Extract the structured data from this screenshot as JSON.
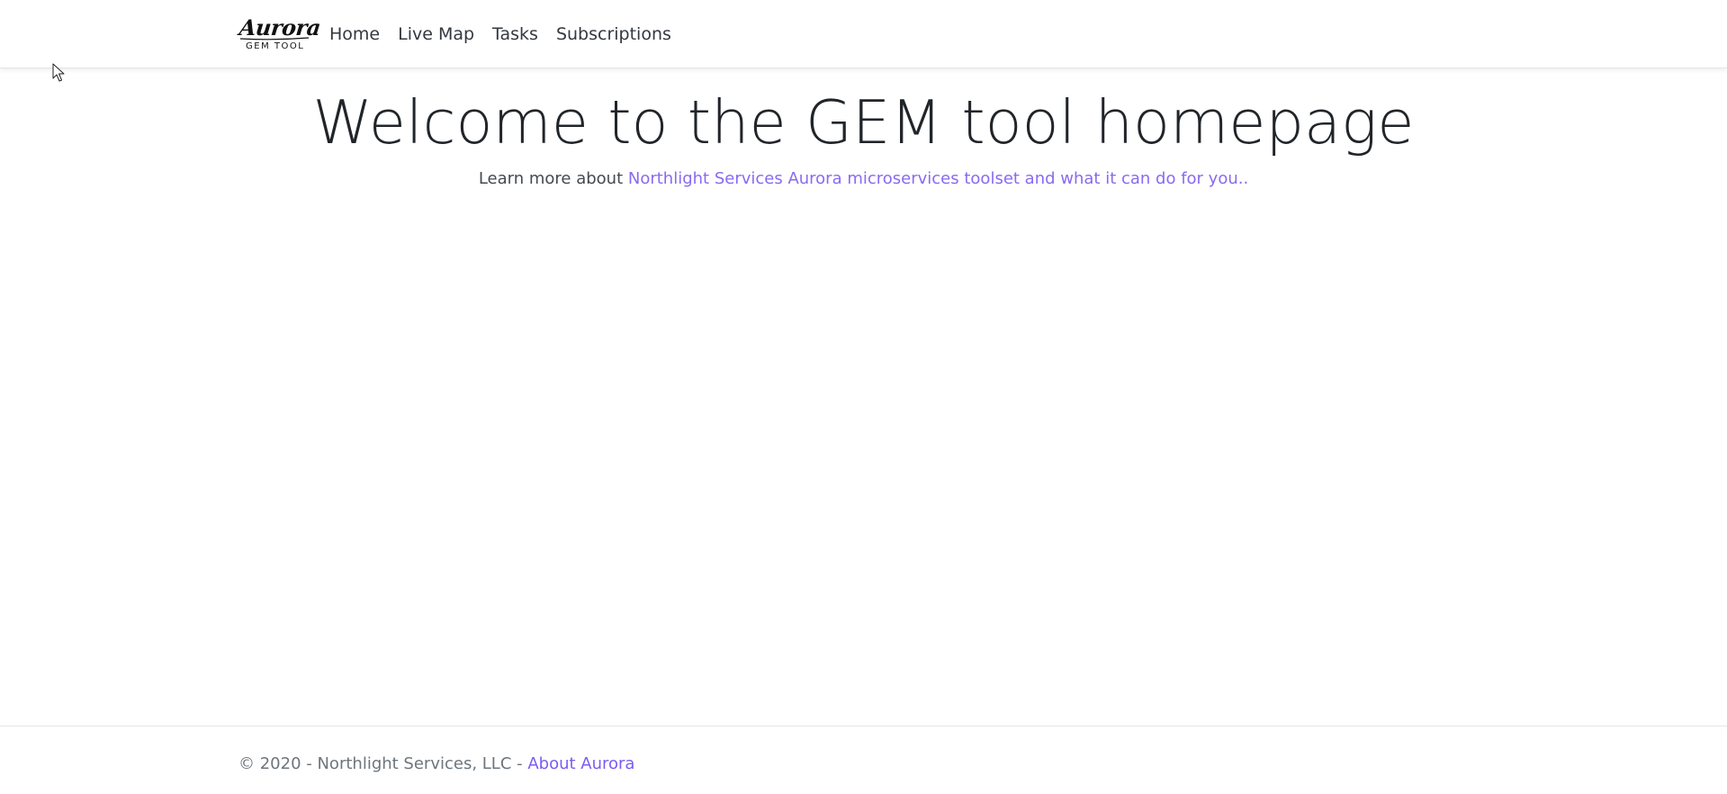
{
  "brand": {
    "script_text": "Aurora",
    "sub_text": "GEM TOOL"
  },
  "nav": {
    "items": [
      {
        "label": "Home"
      },
      {
        "label": "Live Map"
      },
      {
        "label": "Tasks"
      },
      {
        "label": "Subscriptions"
      }
    ]
  },
  "hero": {
    "title": "Welcome to the GEM tool homepage",
    "lead_prefix": "Learn more about ",
    "lead_link": "Northlight Services Aurora microservices toolset and what it can do for you.."
  },
  "footer": {
    "copyright": "© 2020 - Northlight Services, LLC - ",
    "about_link": "About Aurora"
  },
  "colors": {
    "link_accent": "#8a6af0",
    "footer_link": "#7b5cf0",
    "text_dark": "#212529",
    "text_muted": "#6c757d"
  }
}
